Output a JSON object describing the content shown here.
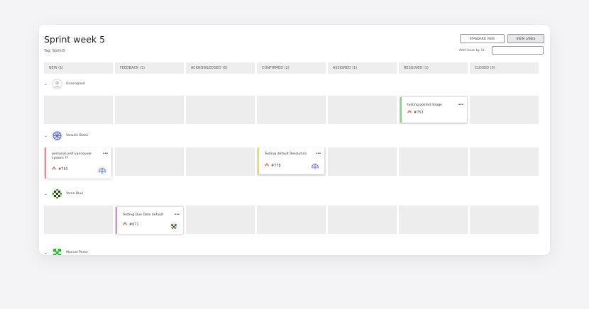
{
  "board": {
    "title": "Sprint week 5",
    "tag": "Tag: Sprint5",
    "standard_view_label": "STANDARD VIEW",
    "swim_lanes_label": "SWIM LANES",
    "add_issue_label": "Add issue by id :",
    "add_issue_value": ""
  },
  "columns": [
    {
      "label": "NEW (1)"
    },
    {
      "label": "FEEDBACK (1)"
    },
    {
      "label": "ACKNOWLEDGED (0)"
    },
    {
      "label": "CONFIRMED (2)"
    },
    {
      "label": "ASSIGNED (1)"
    },
    {
      "label": "RESOLVED (1)"
    },
    {
      "label": "CLOSED (0)"
    }
  ],
  "lanes": [
    {
      "name": "Unassigned",
      "avatar_icon": "default-user-icon"
    },
    {
      "name": "Yorwick Black",
      "avatar_icon": "blue-pattern-avatar-icon"
    },
    {
      "name": "Yoren Blue",
      "avatar_icon": "dark-green-pattern-avatar-icon"
    },
    {
      "name": "Manuel Perez",
      "avatar_icon": "green-pattern-avatar-icon"
    }
  ],
  "issues": [
    {
      "title": "testing posted image",
      "id": "#753",
      "accent": "#7ed67a",
      "more": "•••",
      "priority_icon": "high-priority-icon"
    },
    {
      "title": "personal pref vancouver. system ??",
      "id": "#750",
      "accent": "#f08b8b",
      "more": "•••",
      "priority_icon": "high-priority-icon"
    },
    {
      "title": "Testing default Resolution",
      "id": "#778",
      "accent": "#f5d36b",
      "more": "•••",
      "priority_icon": "high-priority-icon"
    },
    {
      "title": "Testing Due Date default",
      "id": "#671",
      "accent": "#d88ad8",
      "more": "•••",
      "priority_icon": "high-priority-icon"
    }
  ],
  "colors": {
    "priority_high": "#e8603c",
    "cell_bg": "#ededee",
    "header_bg": "#eeeeef"
  }
}
